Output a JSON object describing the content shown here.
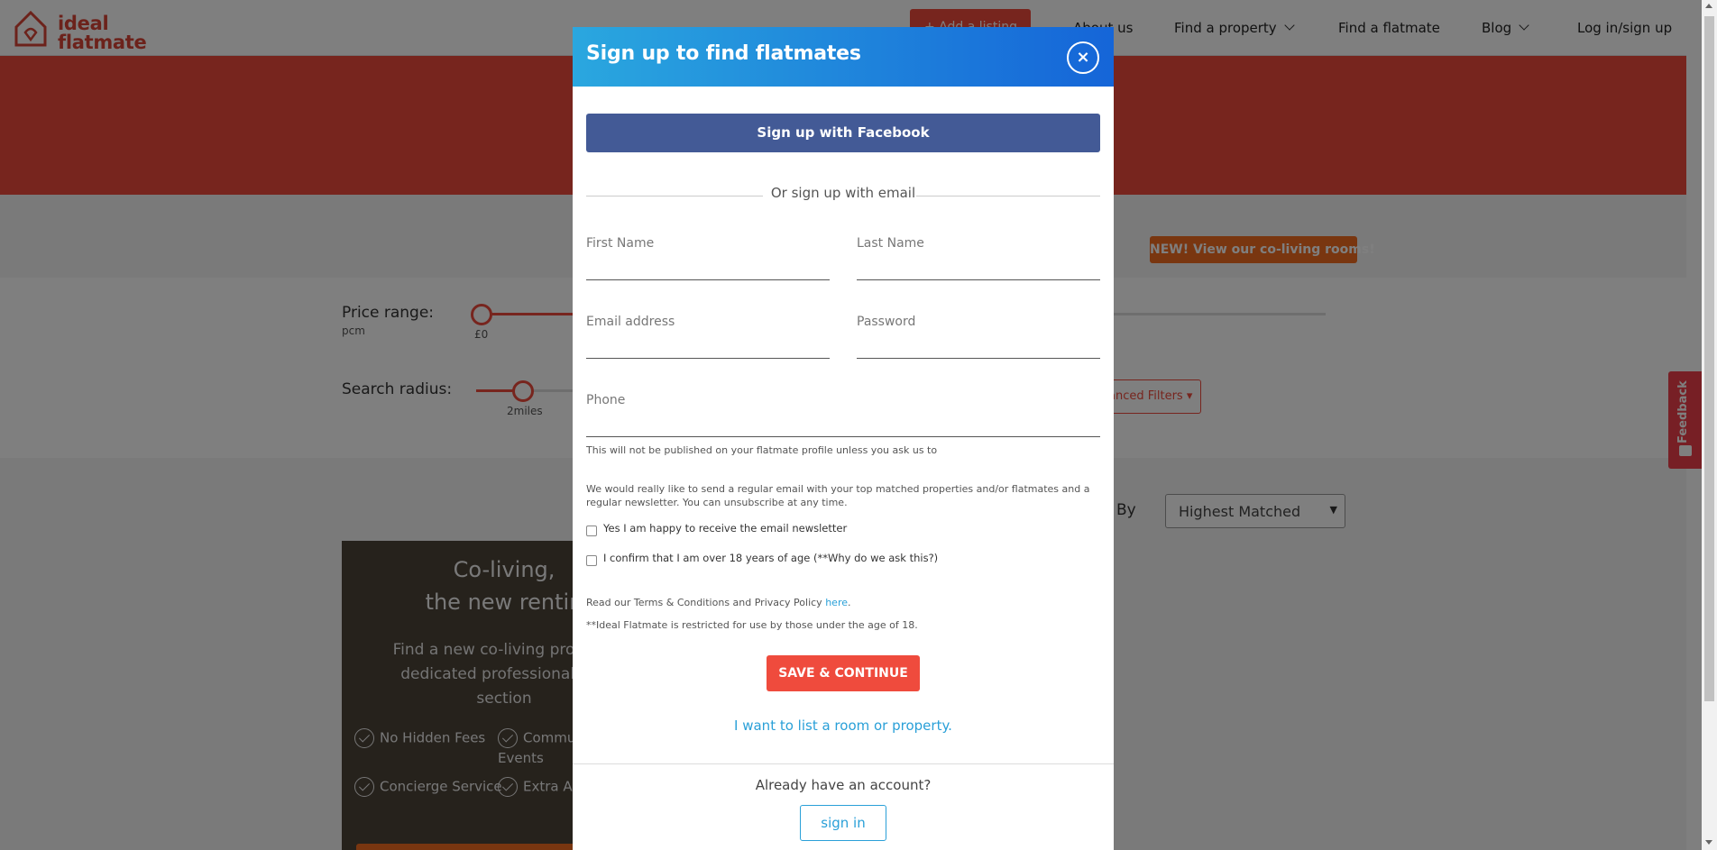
{
  "header": {
    "logo_text_line1": "ideal",
    "logo_text_line2": "flatmate",
    "add_listing_label": "+ Add a listing",
    "nav": {
      "about": "About us",
      "find_property": "Find a property",
      "find_flatmate": "Find a flatmate",
      "blog": "Blog",
      "login": "Log in/sign up"
    }
  },
  "banner": {
    "coliving_badge": "NEW! View our co-living rooms!"
  },
  "filters": {
    "price_label": "Price range:",
    "price_unit": "pcm",
    "price_min_label": "£0",
    "radius_label": "Search radius:",
    "radius_value": "2miles",
    "advanced_label": "anced Filters ▾"
  },
  "results": {
    "sort_label": "By",
    "sort_value": "Highest Matched"
  },
  "promo_card": {
    "title_line1": "Co-living,",
    "title_line2": "the new rentin",
    "text_line1": "Find a new co-living property",
    "text_line2": "dedicated professionally m",
    "text_line3": "section",
    "features": [
      "No Hidden Fees",
      "Commu",
      "Events",
      "Concierge Service",
      "Extra Ar"
    ]
  },
  "feedback_tab": {
    "label": "Feedback"
  },
  "modal": {
    "title": "Sign up to find flatmates",
    "close_symbol": "×",
    "facebook_button": "Sign up with Facebook",
    "divider_text": "Or sign up with email",
    "fields": {
      "first_name": "First Name",
      "last_name": "Last Name",
      "email": "Email address",
      "password": "Password",
      "phone": "Phone"
    },
    "phone_note": "This will not be published on your flatmate profile unless you ask us to",
    "email_note_line1": "We would really like to send a regular email with your top matched properties and/or flatmates and a",
    "email_note_line2": "regular newsletter. You can unsubscribe at any time.",
    "checkbox_newsletter": "Yes I am happy to receive the email newsletter",
    "checkbox_age": "I confirm that I am over 18 years of age (**Why do we ask this?)",
    "terms_text": "Read our Terms & Conditions and Privacy Policy",
    "terms_link": "here",
    "terms_end": ".",
    "restriction_note": "**Ideal Flatmate is restricted for use by those under the age of 18.",
    "save_button": "SAVE & CONTINUE",
    "list_link": "I want to list a room or property.",
    "account_text": "Already have an account?",
    "signin_button": "sign in"
  },
  "colors": {
    "brand_red": "#ef4b3d",
    "facebook_blue": "#435a96",
    "header_gradient_start": "#2aa7df",
    "header_gradient_end": "#1565d8",
    "link_blue": "#2aa0d8",
    "coliving_orange": "#f26d21"
  }
}
